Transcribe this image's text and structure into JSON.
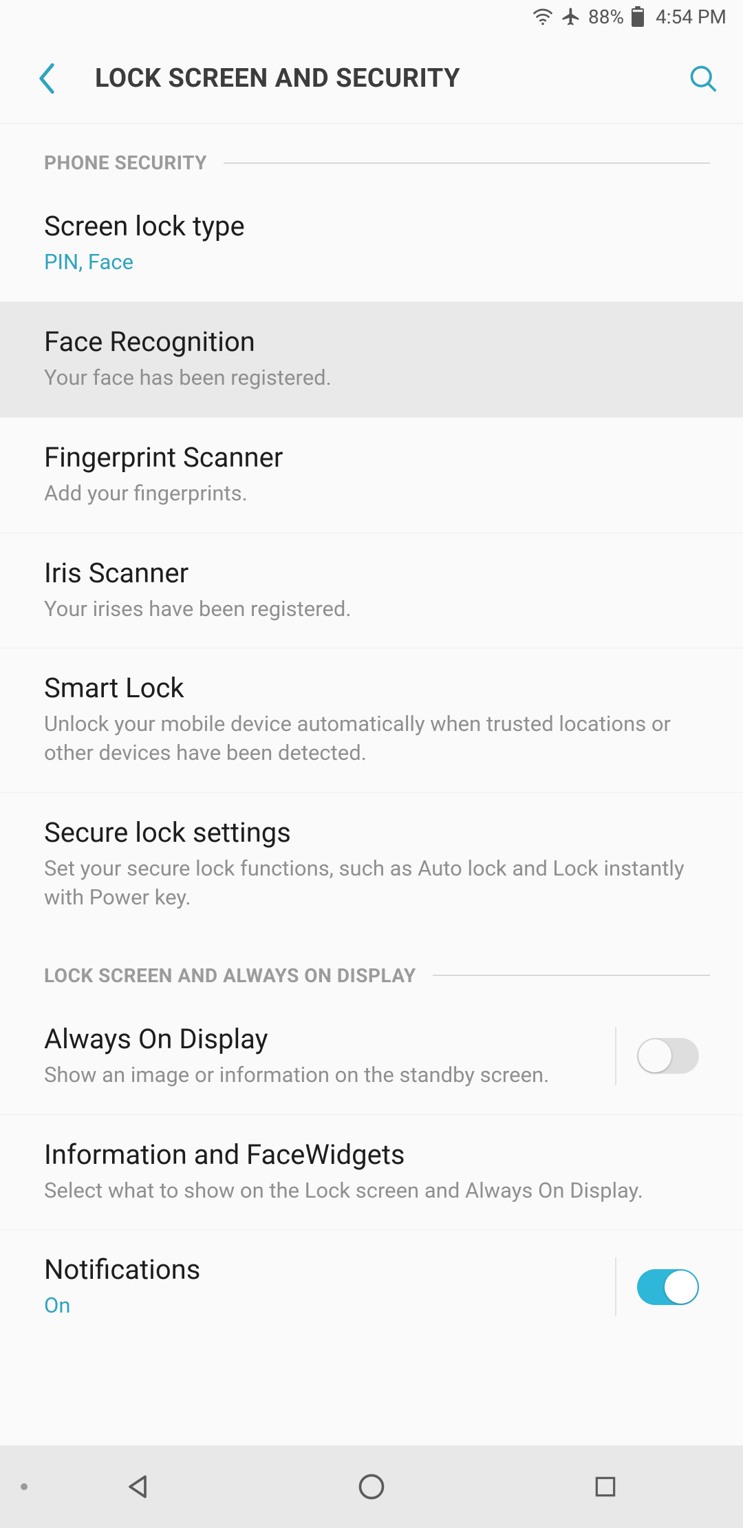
{
  "status": {
    "battery": "88%",
    "time": "4:54 PM"
  },
  "appbar": {
    "title": "LOCK SCREEN AND SECURITY"
  },
  "sections": [
    {
      "label": "PHONE SECURITY"
    },
    {
      "label": "LOCK SCREEN AND ALWAYS ON DISPLAY"
    }
  ],
  "rows": {
    "screen_lock_type": {
      "title": "Screen lock type",
      "sub": "PIN, Face"
    },
    "face_recognition": {
      "title": "Face Recognition",
      "sub": "Your face has been registered."
    },
    "fingerprint": {
      "title": "Fingerprint Scanner",
      "sub": "Add your fingerprints."
    },
    "iris": {
      "title": "Iris Scanner",
      "sub": "Your irises have been registered."
    },
    "smart_lock": {
      "title": "Smart Lock",
      "sub": "Unlock your mobile device automatically when trusted locations or other devices have been detected."
    },
    "secure_lock": {
      "title": "Secure lock settings",
      "sub": "Set your secure lock functions, such as Auto lock and Lock instantly with Power key."
    },
    "aod": {
      "title": "Always On Display",
      "sub": "Show an image or information on the standby screen.",
      "enabled": false
    },
    "info_widgets": {
      "title": "Information and FaceWidgets",
      "sub": "Select what to show on the Lock screen and Always On Display."
    },
    "notifications": {
      "title": "Notifications",
      "sub": "On",
      "enabled": true
    }
  }
}
